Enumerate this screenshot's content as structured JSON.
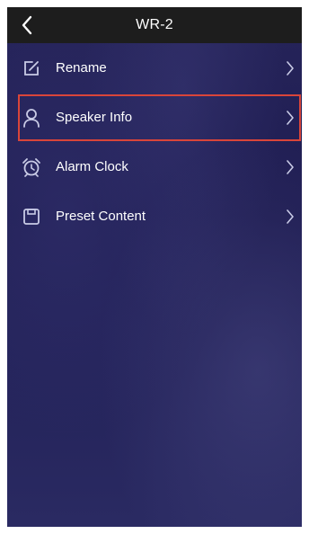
{
  "header": {
    "title": "WR-2",
    "back_icon": "chevron-left-icon"
  },
  "menu": {
    "items": [
      {
        "label": "Rename",
        "icon": "edit-icon"
      },
      {
        "label": "Speaker Info",
        "icon": "user-icon",
        "highlighted": true
      },
      {
        "label": "Alarm Clock",
        "icon": "alarm-clock-icon"
      },
      {
        "label": "Preset Content",
        "icon": "save-icon"
      }
    ]
  },
  "colors": {
    "header_bg": "#1d1d1d",
    "background": "#25245a",
    "text": "#ffffff",
    "icon": "#c9cbe6",
    "highlight": "#d9453a"
  }
}
